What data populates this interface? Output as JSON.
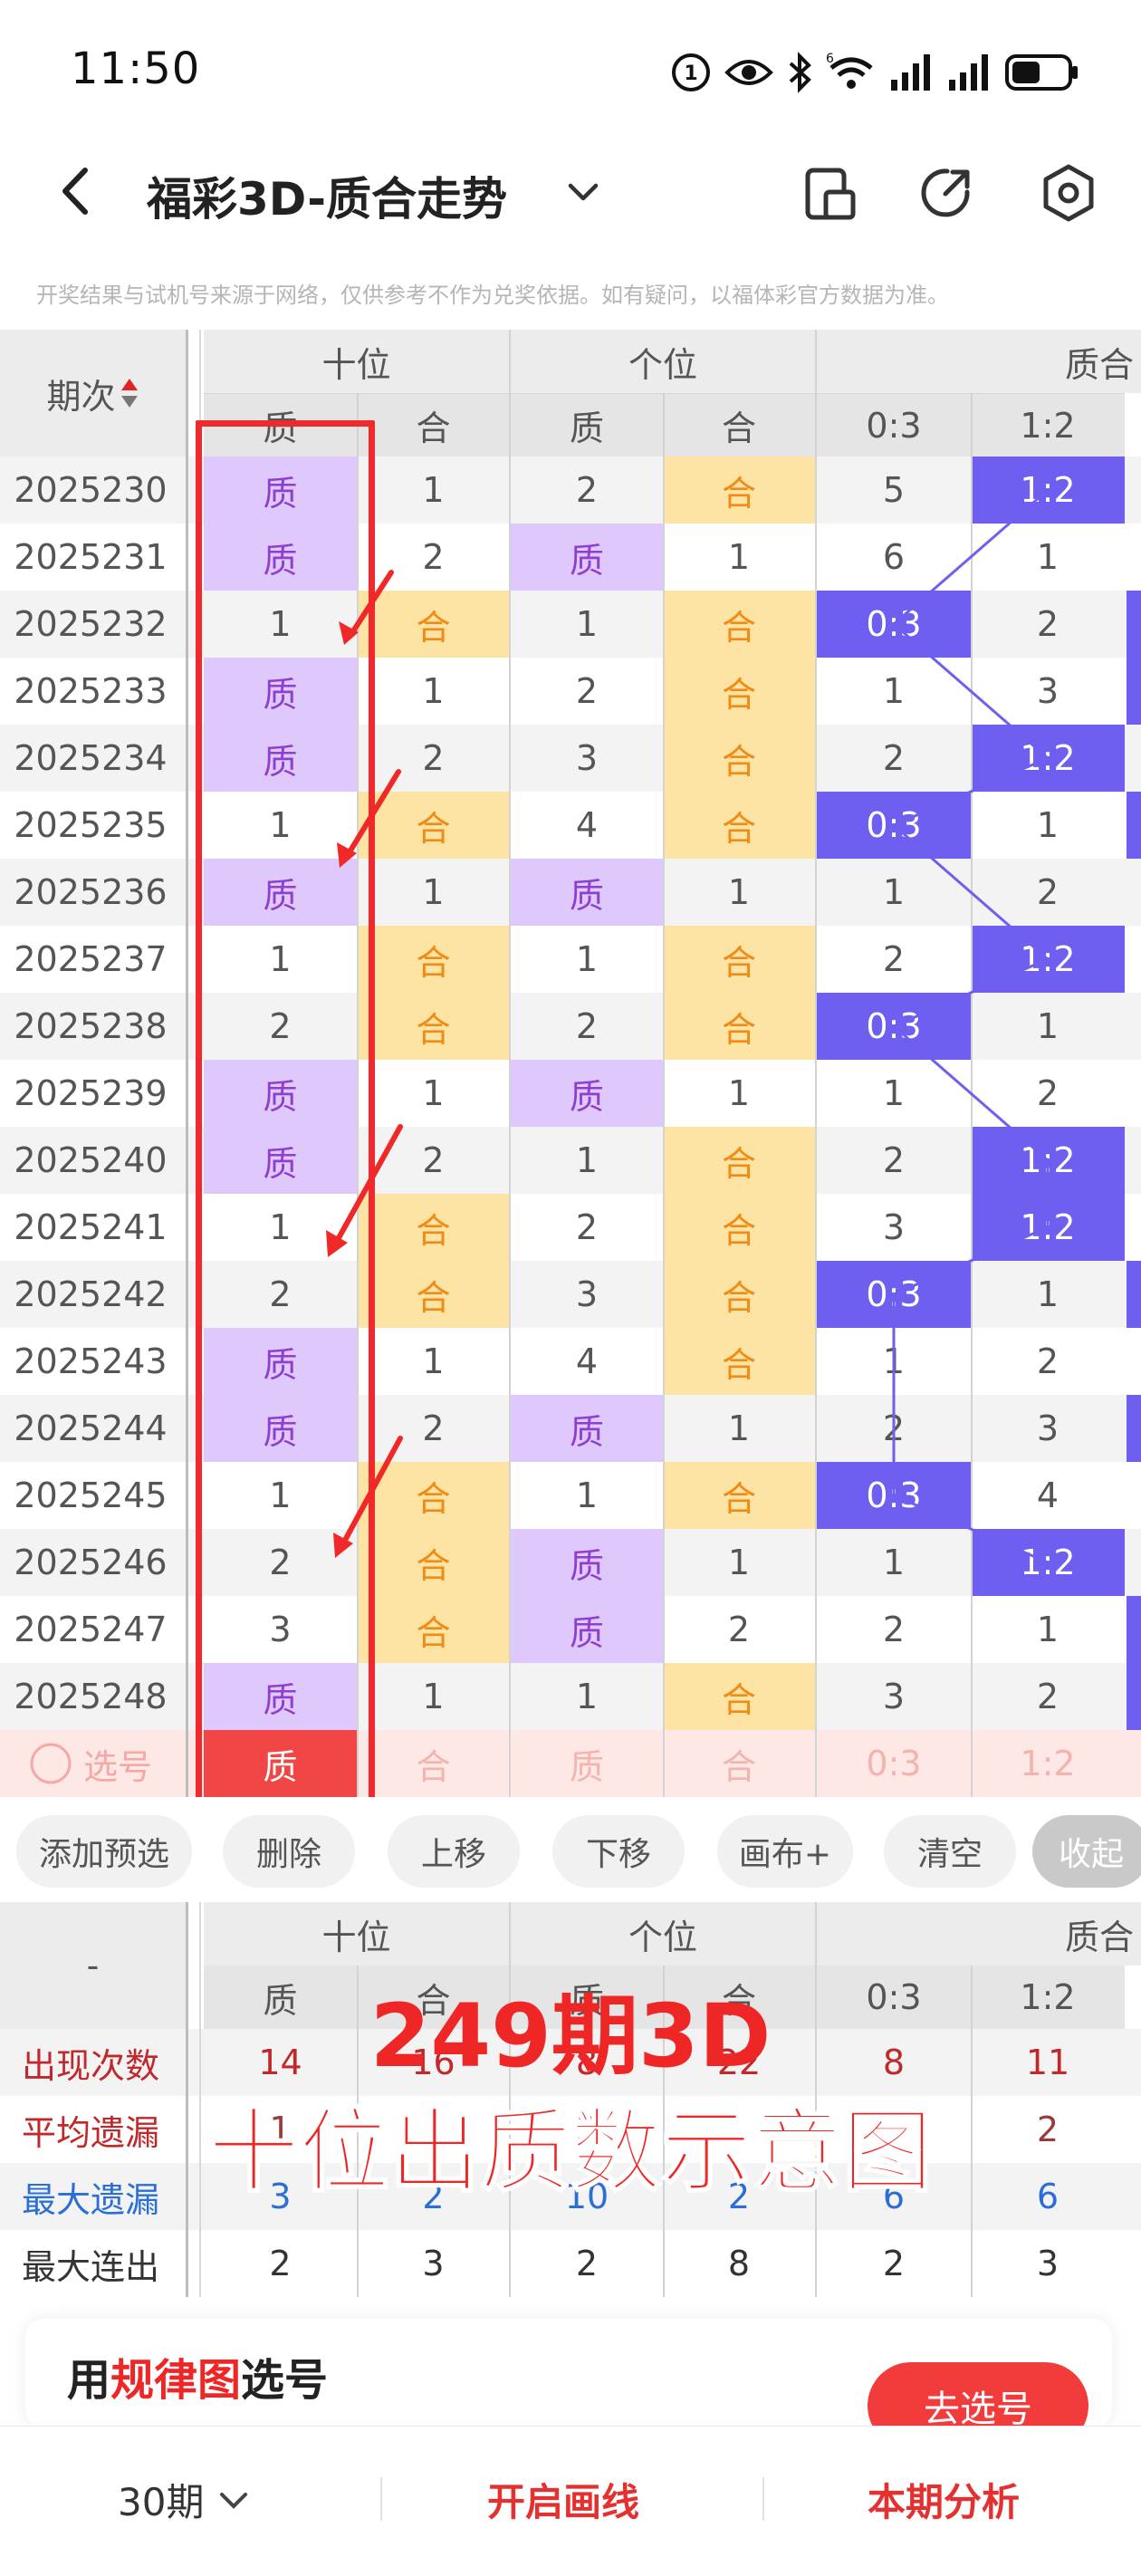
{
  "status_bar": {
    "time": "11:50"
  },
  "nav": {
    "title": "福彩3D-质合走势"
  },
  "disclaimer": "开奖结果与试机号来源于网络，仅供参考不作为兑奖依据。如有疑问，以福体彩官方数据为准。",
  "table": {
    "period_header": "期次",
    "groups": [
      "十位",
      "个位",
      "质合"
    ],
    "sub_headers": [
      "质",
      "合",
      "质",
      "合",
      "0:3",
      "1:2"
    ],
    "rows": [
      {
        "period": "2025230",
        "cells": [
          "质",
          "1",
          "2",
          "合",
          "5",
          "1:2"
        ]
      },
      {
        "period": "2025231",
        "cells": [
          "质",
          "2",
          "质",
          "1",
          "6",
          "1"
        ]
      },
      {
        "period": "2025232",
        "cells": [
          "1",
          "合",
          "1",
          "合",
          "0:3",
          "2"
        ]
      },
      {
        "period": "2025233",
        "cells": [
          "质",
          "1",
          "2",
          "合",
          "1",
          "3"
        ]
      },
      {
        "period": "2025234",
        "cells": [
          "质",
          "2",
          "3",
          "合",
          "2",
          "1:2"
        ]
      },
      {
        "period": "2025235",
        "cells": [
          "1",
          "合",
          "4",
          "合",
          "0:3",
          "1"
        ]
      },
      {
        "period": "2025236",
        "cells": [
          "质",
          "1",
          "质",
          "1",
          "1",
          "2"
        ]
      },
      {
        "period": "2025237",
        "cells": [
          "1",
          "合",
          "1",
          "合",
          "2",
          "1:2"
        ]
      },
      {
        "period": "2025238",
        "cells": [
          "2",
          "合",
          "2",
          "合",
          "0:3",
          "1"
        ]
      },
      {
        "period": "2025239",
        "cells": [
          "质",
          "1",
          "质",
          "1",
          "1",
          "2"
        ]
      },
      {
        "period": "2025240",
        "cells": [
          "质",
          "2",
          "1",
          "合",
          "2",
          "1:2"
        ]
      },
      {
        "period": "2025241",
        "cells": [
          "1",
          "合",
          "2",
          "合",
          "3",
          "1:2"
        ]
      },
      {
        "period": "2025242",
        "cells": [
          "2",
          "合",
          "3",
          "合",
          "0:3",
          "1"
        ]
      },
      {
        "period": "2025243",
        "cells": [
          "质",
          "1",
          "4",
          "合",
          "1",
          "2"
        ]
      },
      {
        "period": "2025244",
        "cells": [
          "质",
          "2",
          "质",
          "1",
          "2",
          "3"
        ]
      },
      {
        "period": "2025245",
        "cells": [
          "1",
          "合",
          "1",
          "合",
          "0:3",
          "4"
        ]
      },
      {
        "period": "2025246",
        "cells": [
          "2",
          "合",
          "质",
          "1",
          "1",
          "1:2"
        ]
      },
      {
        "period": "2025247",
        "cells": [
          "3",
          "合",
          "质",
          "2",
          "2",
          "1"
        ]
      },
      {
        "period": "2025248",
        "cells": [
          "质",
          "1",
          "1",
          "合",
          "3",
          "2"
        ]
      }
    ],
    "select_row": {
      "label": "选号",
      "cells": [
        "质",
        "合",
        "质",
        "合",
        "0:3",
        "1:2"
      ]
    }
  },
  "buttons": {
    "add": "添加预选",
    "delete": "删除",
    "up": "上移",
    "down": "下移",
    "canvas": "画布+",
    "clear": "清空",
    "collapse": "收起"
  },
  "stats": {
    "corner": "-",
    "groups": [
      "十位",
      "个位",
      "质合"
    ],
    "sub_headers": [
      "质",
      "合",
      "质",
      "合",
      "0:3",
      "1:2"
    ],
    "rows": [
      {
        "label": "出现次数",
        "values": [
          "14",
          "16",
          "8",
          "22",
          "8",
          "11"
        ]
      },
      {
        "label": "平均遗漏",
        "values": [
          "1",
          "",
          "3",
          "",
          "",
          "2"
        ]
      },
      {
        "label": "最大遗漏",
        "values": [
          "3",
          "2",
          "10",
          "2",
          "6",
          "6"
        ]
      },
      {
        "label": "最大连出",
        "values": [
          "2",
          "3",
          "2",
          "8",
          "2",
          "3"
        ]
      }
    ]
  },
  "overlay": {
    "line1": "249期3D",
    "line2": "十位出质数示意图"
  },
  "card": {
    "prefix": "用",
    "highlight": "规律图",
    "suffix": "选号",
    "button": "去选号"
  },
  "bottom": {
    "periods": "30期",
    "draw": "开启画线",
    "analysis": "本期分析"
  },
  "colors": {
    "prime_bg": "#dfc8fb",
    "prime_text": "#8e3fd0",
    "composite_bg": "#fde3a4",
    "composite_text": "#f08b15",
    "ratio_bg": "#6e5ff0",
    "accent_red": "#ef2626"
  }
}
